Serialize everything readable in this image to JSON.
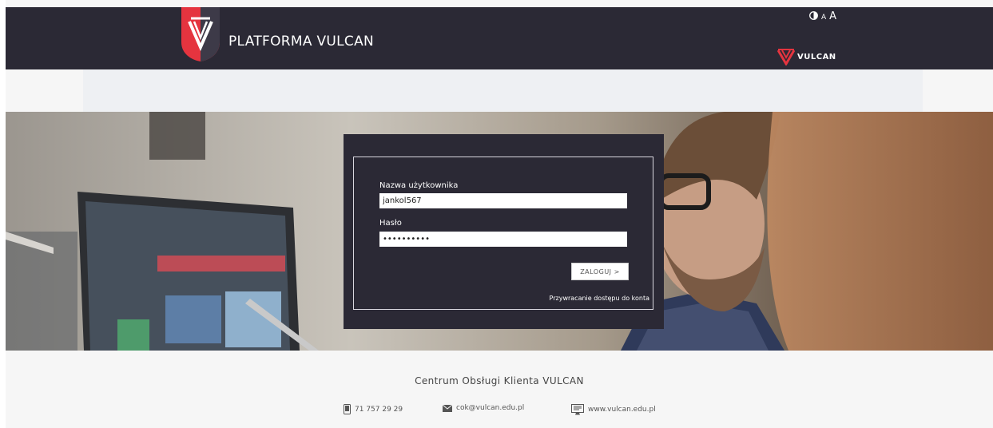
{
  "header": {
    "title": "PLATFORMA VULCAN",
    "logo_icon": "vulcan-shield-logo",
    "accessibility": {
      "contrast_icon": "contrast-icon",
      "font_small": "A",
      "font_large": "A"
    },
    "brand_logo_text": "VULCAN"
  },
  "login": {
    "username_label": "Nazwa użytkownika",
    "username_value": "jankol567",
    "password_label": "Hasło",
    "password_value": "••••••••••",
    "submit_label": "ZALOGUJ >",
    "recover_link": "Przywracanie dostępu do konta"
  },
  "footer": {
    "title": "Centrum Obsługi Klienta VULCAN",
    "phone": "71 757 29 29",
    "email": "cok@vulcan.edu.pl",
    "website": "www.vulcan.edu.pl"
  },
  "colors": {
    "header_bg": "#2b2935",
    "accent_red": "#e5343f",
    "footer_bg": "#f6f6f6"
  }
}
